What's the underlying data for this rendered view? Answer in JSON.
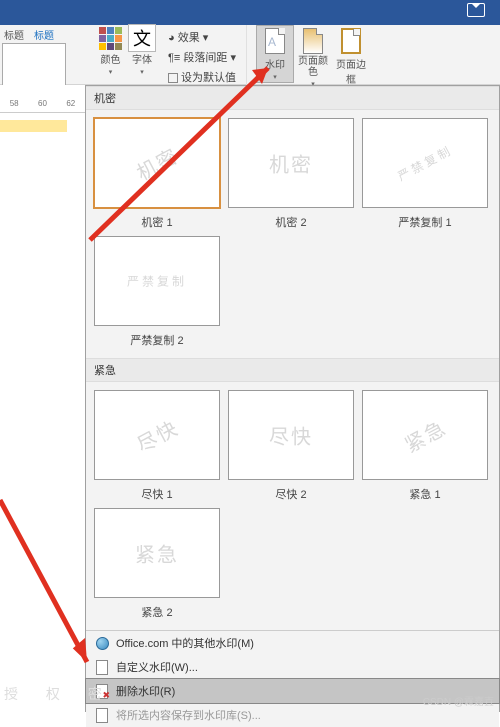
{
  "titlebar": {},
  "nav": {
    "label1": "标题",
    "label2": "标题"
  },
  "ribbon": {
    "color": "颜色",
    "font": "字体",
    "font_glyph": "文",
    "effect": "效果",
    "para_spacing": "段落间距",
    "set_default": "设为默认值",
    "watermark": "水印",
    "page_color": "页面颜色",
    "page_border": "页面边框"
  },
  "panel": {
    "section1": "机密",
    "section2": "紧急",
    "items1": [
      {
        "text": "机密",
        "diag": true,
        "cap": "机密 1"
      },
      {
        "text": "机密",
        "diag": false,
        "cap": "机密 2"
      },
      {
        "text": "严禁复制",
        "diag": true,
        "cap": "严禁复制 1",
        "en": true
      },
      {
        "text": "严禁复制",
        "diag": false,
        "cap": "严禁复制 2",
        "en": true
      }
    ],
    "items2": [
      {
        "text": "尽快",
        "diag": true,
        "cap": "尽快 1"
      },
      {
        "text": "尽快",
        "diag": false,
        "cap": "尽快 2"
      },
      {
        "text": "紧急",
        "diag": true,
        "cap": "紧急 1"
      },
      {
        "text": "紧急",
        "diag": false,
        "cap": "紧急 2"
      }
    ],
    "menu": {
      "office_more": "Office.com 中的其他水印(M)",
      "custom": "自定义水印(W)...",
      "remove": "删除水印(R)",
      "save_sel": "将所选内容保存到水印库(S)..."
    }
  },
  "ruler": {
    "t1": "58",
    "t2": "60",
    "t3": "62"
  },
  "footer": "授 权 密",
  "csdn": "CSDN @霖嘉壵"
}
